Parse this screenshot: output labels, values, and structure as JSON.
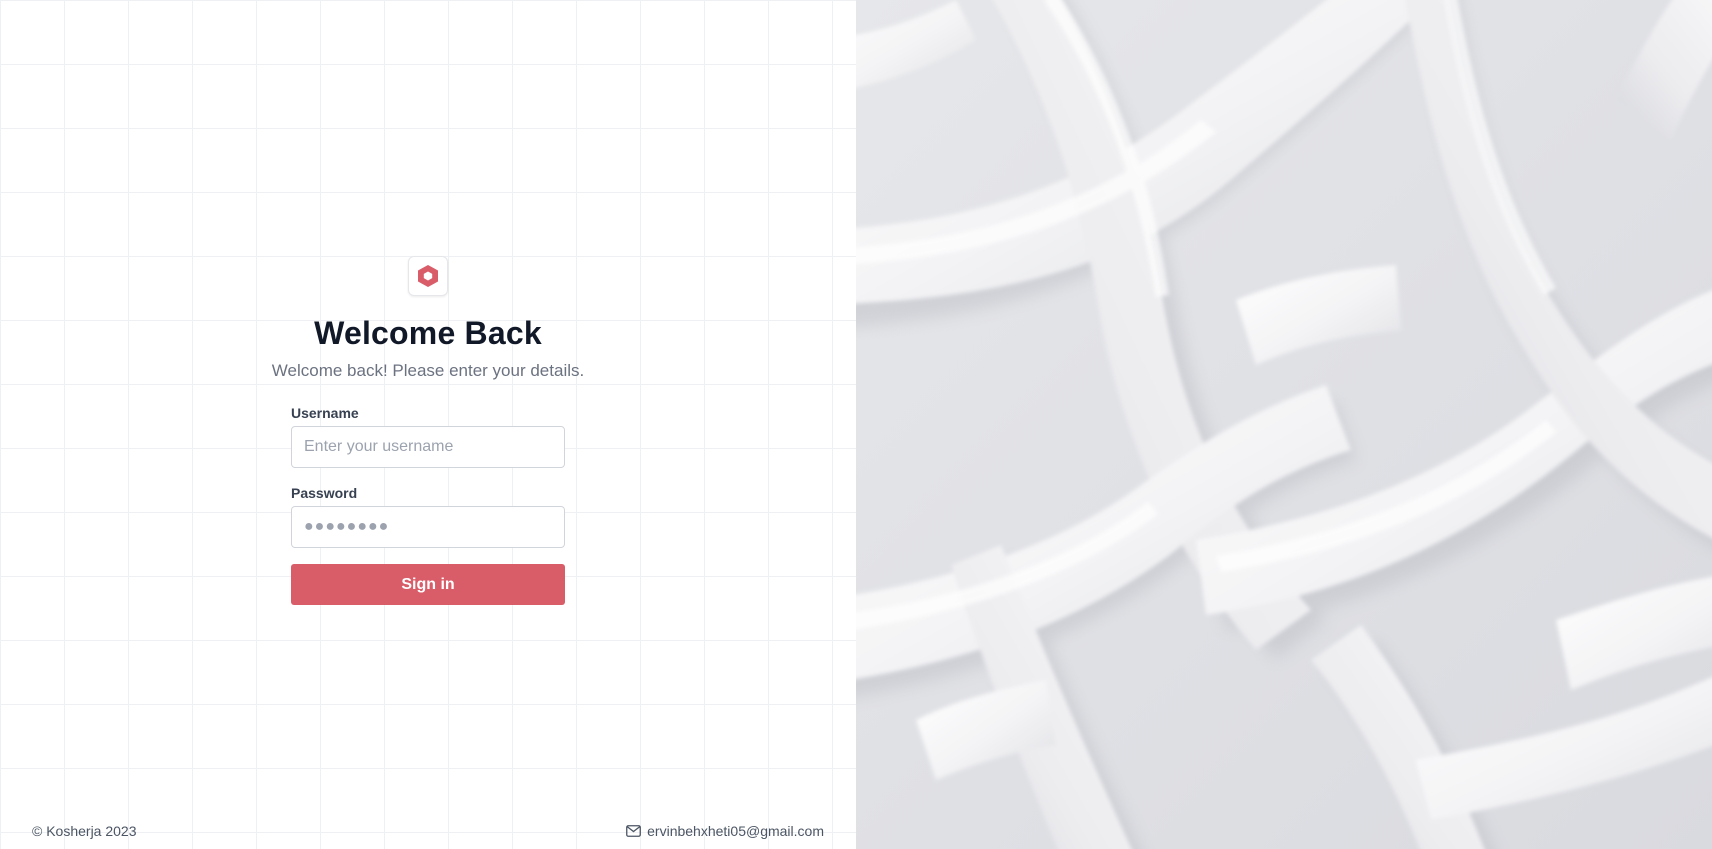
{
  "login": {
    "title": "Welcome Back",
    "subtitle": "Welcome back! Please enter your details.",
    "username_label": "Username",
    "username_placeholder": "Enter your username",
    "password_label": "Password",
    "password_placeholder": "●●●●●●●●",
    "signin_label": "Sign in"
  },
  "footer": {
    "copyright": "© Kosherja 2023",
    "email": "ervinbehxheti05@gmail.com"
  },
  "icons": {
    "logo": "hexagon-logo-icon",
    "email": "mail-icon"
  },
  "colors": {
    "accent": "#d95c69",
    "title": "#111827",
    "muted": "#6b7280"
  }
}
